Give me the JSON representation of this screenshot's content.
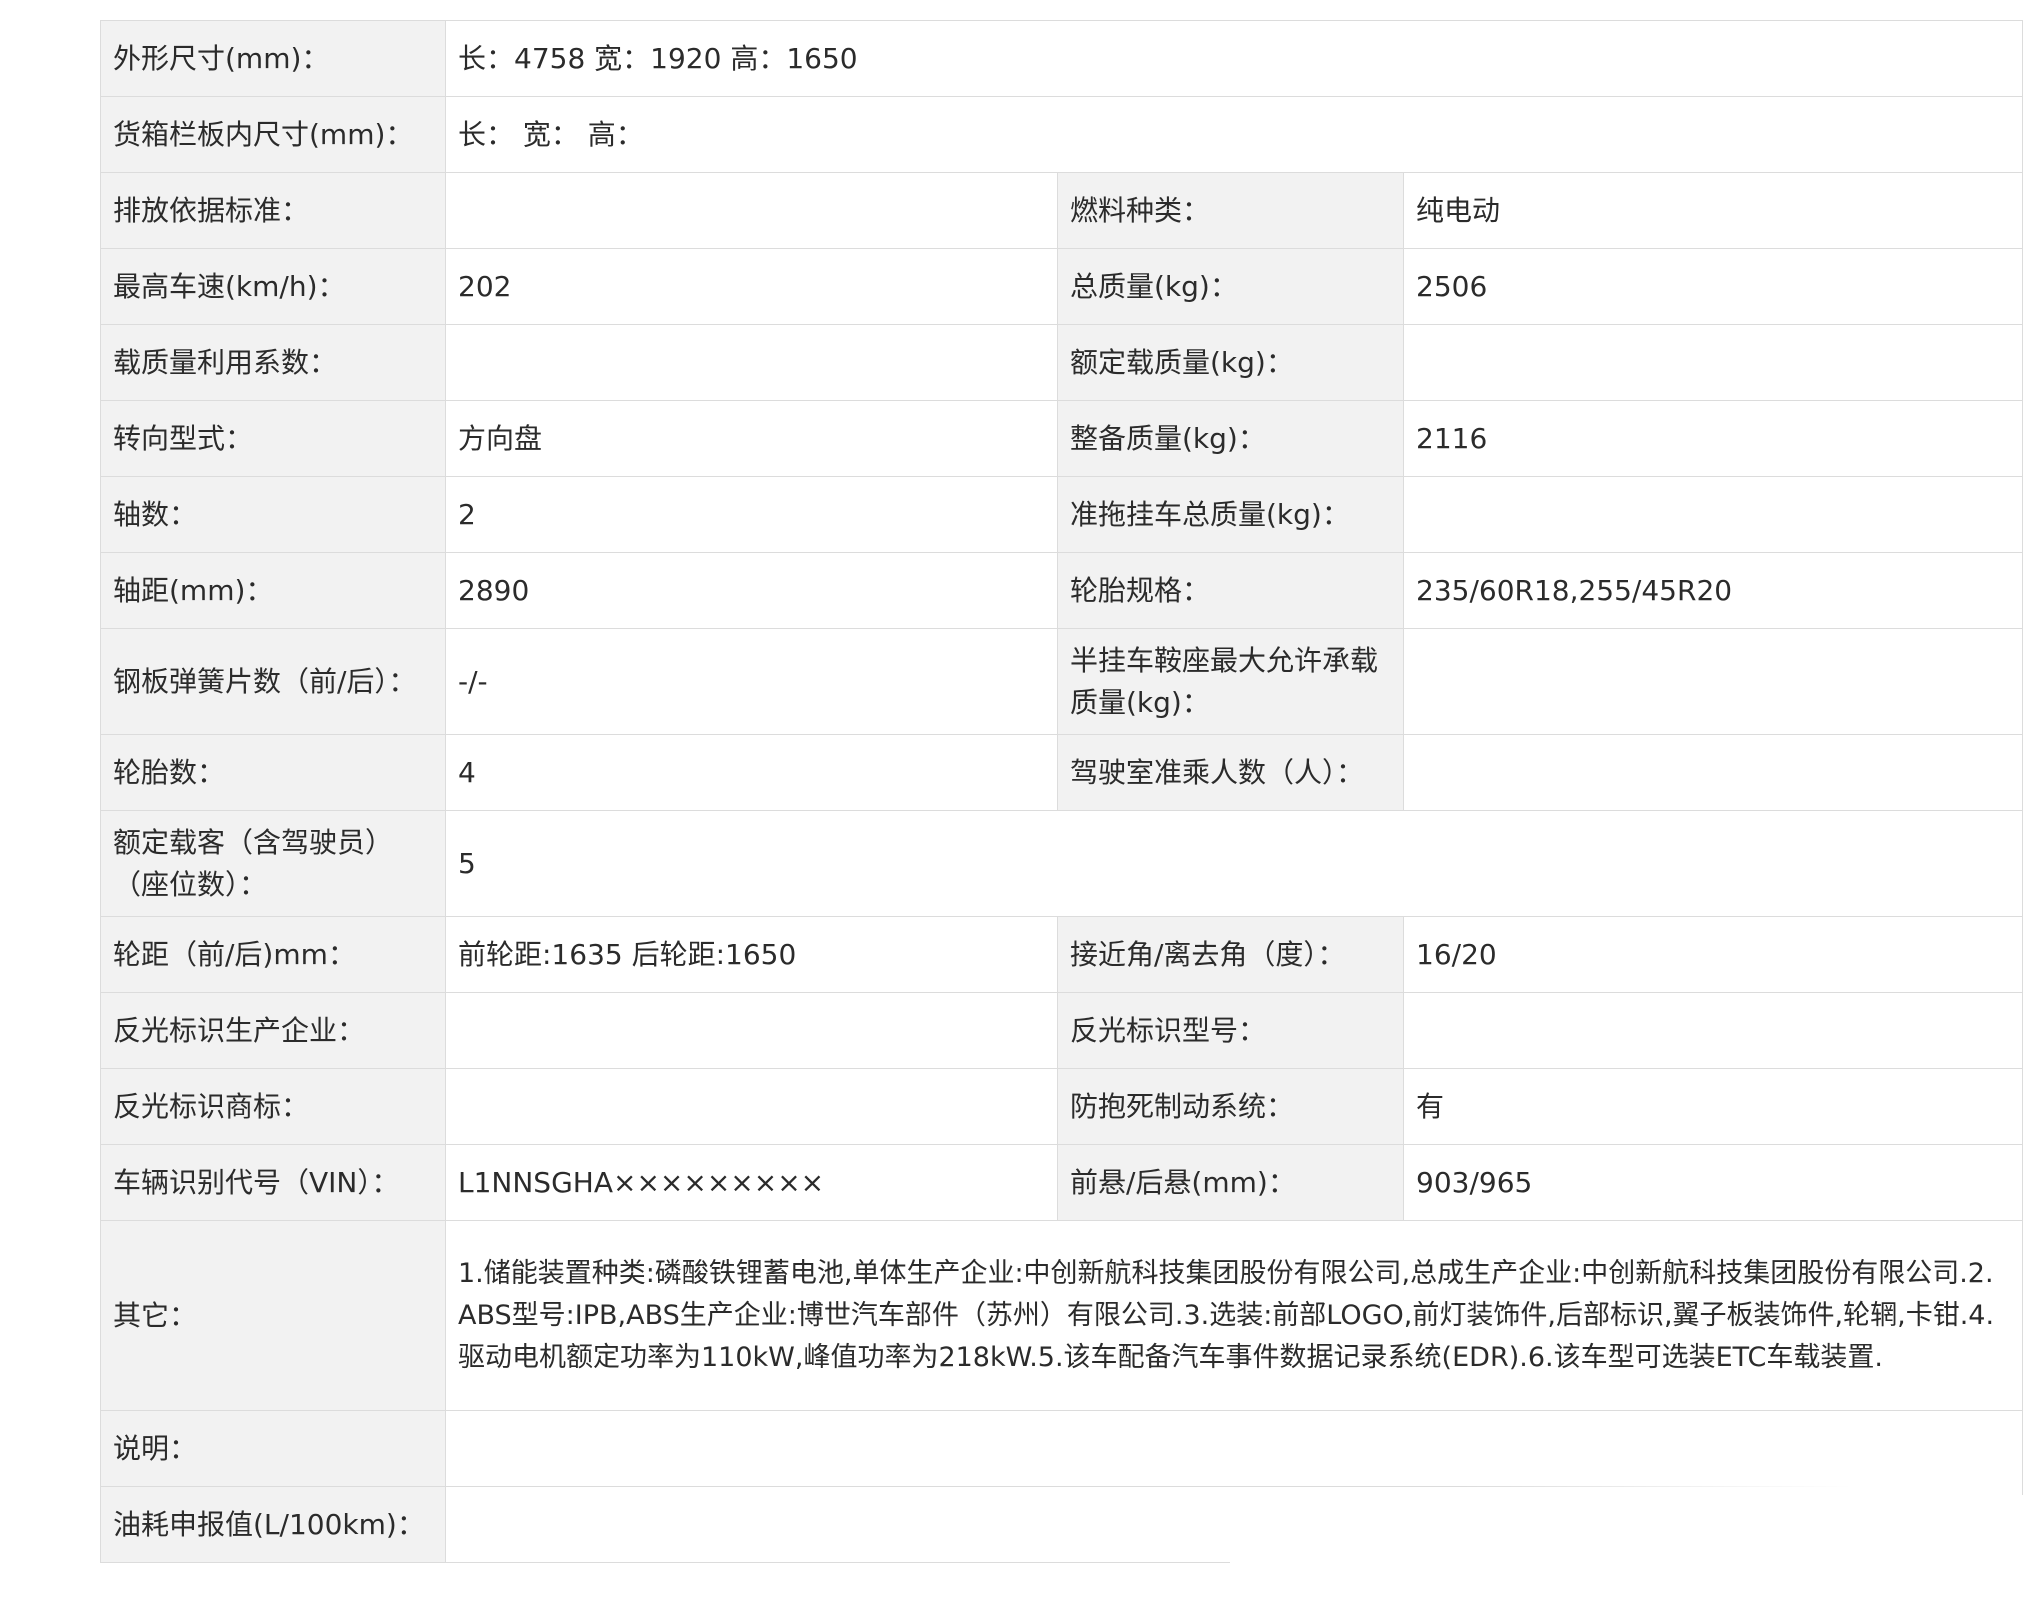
{
  "rows": [
    {
      "l1": "外形尺寸(mm)：",
      "v1": "长：4758 宽：1920 高：1650"
    },
    {
      "l1": "货箱栏板内尺寸(mm)：",
      "v1": "长：  宽：  高："
    },
    {
      "l1": "排放依据标准：",
      "v1": "",
      "l2": "燃料种类：",
      "v2": "纯电动"
    },
    {
      "l1": "最高车速(km/h)：",
      "v1": "202",
      "l2": "总质量(kg)：",
      "v2": "2506"
    },
    {
      "l1": "载质量利用系数：",
      "v1": "",
      "l2": "额定载质量(kg)：",
      "v2": ""
    },
    {
      "l1": "转向型式：",
      "v1": "方向盘",
      "l2": "整备质量(kg)：",
      "v2": "2116"
    },
    {
      "l1": "轴数：",
      "v1": "2",
      "l2": "准拖挂车总质量(kg)：",
      "v2": ""
    },
    {
      "l1": "轴距(mm)：",
      "v1": "2890",
      "l2": "轮胎规格：",
      "v2": "235/60R18,255/45R20"
    },
    {
      "l1": "钢板弹簧片数（前/后）：",
      "v1": "-/-",
      "l2": "半挂车鞍座最大允许承载质量(kg)：",
      "v2": ""
    },
    {
      "l1": "轮胎数：",
      "v1": "4",
      "l2": "驾驶室准乘人数（人）：",
      "v2": ""
    },
    {
      "l1": "额定载客（含驾驶员）（座位数）：",
      "v1": "5"
    },
    {
      "l1": "轮距（前/后)mm：",
      "v1": "前轮距:1635 后轮距:1650",
      "l2": "接近角/离去角（度）：",
      "v2": "16/20"
    },
    {
      "l1": "反光标识生产企业：",
      "v1": "",
      "l2": "反光标识型号：",
      "v2": ""
    },
    {
      "l1": "反光标识商标：",
      "v1": "",
      "l2": "防抱死制动系统：",
      "v2": "有"
    },
    {
      "l1": "车辆识别代号（VIN）：",
      "v1": "L1NNSGHA×××××××××",
      "l2": "前悬/后悬(mm)：",
      "v2": "903/965"
    },
    {
      "l1": "其它：",
      "v1": "1.储能装置种类:磷酸铁锂蓄电池,单体生产企业:中创新航科技集团股份有限公司,总成生产企业:中创新航科技集团股份有限公司.2.ABS型号:IPB,ABS生产企业:博世汽车部件（苏州）有限公司.3.选装:前部LOGO,前灯装饰件,后部标识,翼子板装饰件,轮辋,卡钳.4.驱动电机额定功率为110kW,峰值功率为218kW.5.该车配备汽车事件数据记录系统(EDR).6.该车型可选装ETC车载装置."
    },
    {
      "l1": "说明：",
      "v1": ""
    },
    {
      "l1": "油耗申报值(L/100km)：",
      "v1": ""
    }
  ]
}
